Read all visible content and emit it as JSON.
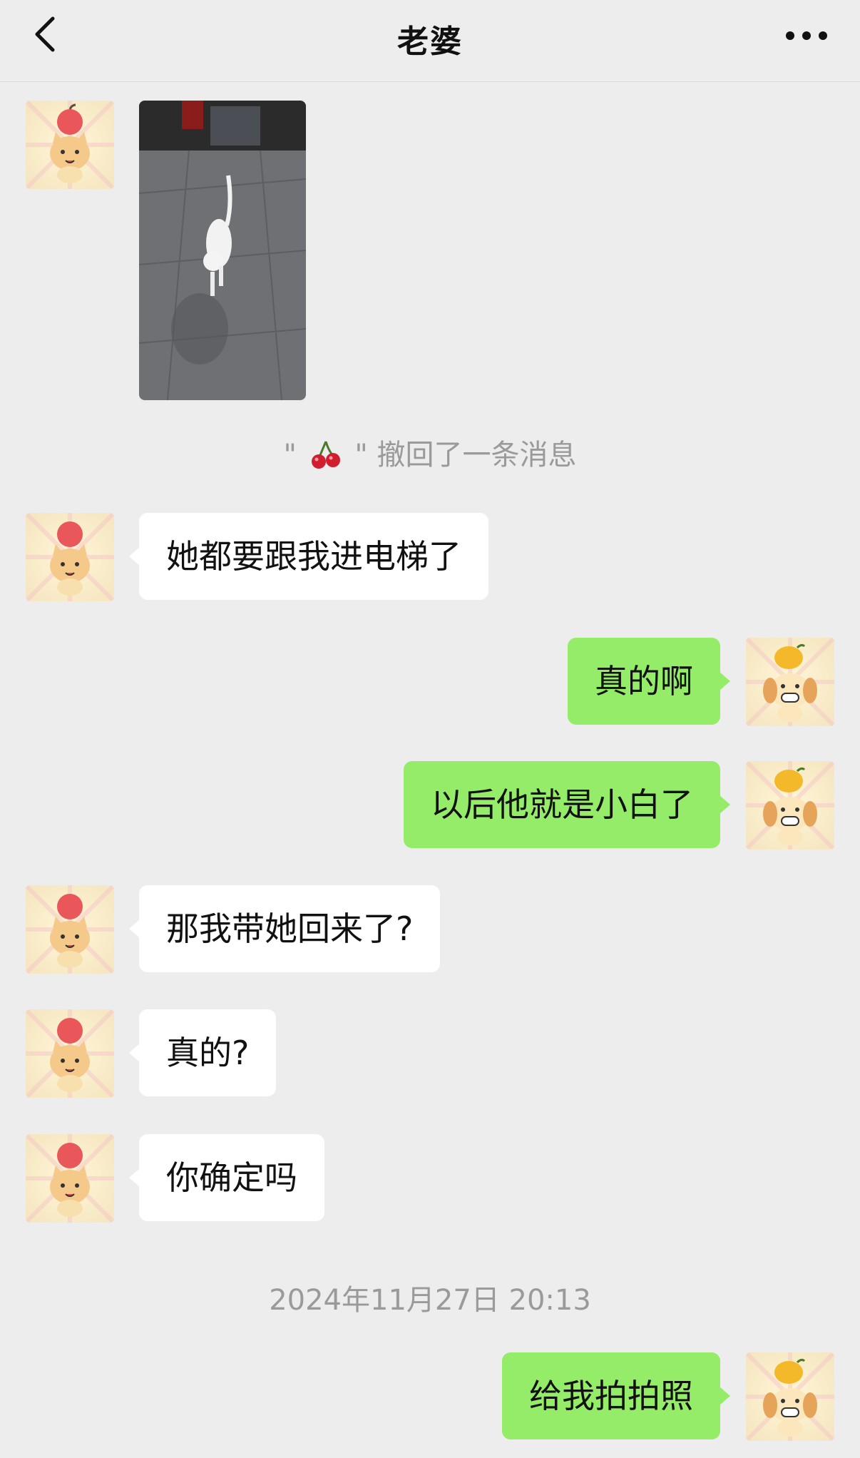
{
  "header": {
    "title": "老婆",
    "back_icon": "chevron-left-icon",
    "more_icon": "more-dots-icon"
  },
  "messages": [
    {
      "side": "in",
      "type": "image",
      "avatar": "cat-apple-avatar"
    },
    {
      "side": "in",
      "type": "text",
      "text": "她都要跟我进电梯了"
    },
    {
      "side": "out",
      "type": "text",
      "text": "真的啊"
    },
    {
      "side": "out",
      "type": "text",
      "text": "以后他就是小白了"
    },
    {
      "side": "in",
      "type": "text",
      "text": "那我带她回来了?"
    },
    {
      "side": "in",
      "type": "text",
      "text": "真的?"
    },
    {
      "side": "in",
      "type": "text",
      "text": "你确定吗"
    },
    {
      "side": "out",
      "type": "text",
      "text": "给我拍拍照"
    }
  ],
  "system": {
    "recall_quote_open": "\"",
    "recall_quote_close": "\"",
    "recall_text": "撤回了一条消息",
    "recall_icon": "cherry-icon",
    "timestamp": "2024年11月27日 20:13"
  },
  "colors": {
    "background": "#ededed",
    "incoming_bubble": "#ffffff",
    "outgoing_bubble": "#95ec69",
    "system_text": "#9a9a9a"
  }
}
